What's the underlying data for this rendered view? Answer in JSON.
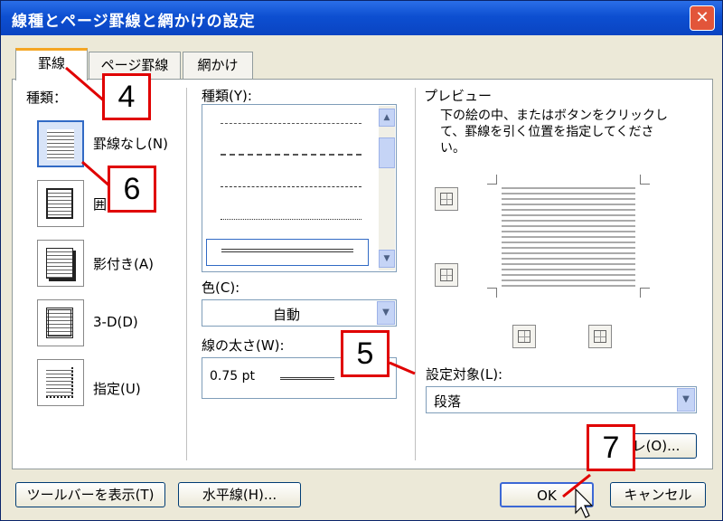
{
  "window": {
    "title": "線種とページ罫線と網かけの設定",
    "close_glyph": "✕"
  },
  "tabs": [
    {
      "label": "罫線"
    },
    {
      "label": "ページ罫線"
    },
    {
      "label": "網かけ"
    }
  ],
  "setting": {
    "label": "種類：",
    "items": [
      {
        "label": "罫線なし(N)"
      },
      {
        "label": "囲"
      },
      {
        "label": "影付き(A)"
      },
      {
        "label": "3-D(D)"
      },
      {
        "label": "指定(U)"
      }
    ]
  },
  "style": {
    "label": "種類(Y):",
    "scroll_up": "▲",
    "scroll_down": "▼"
  },
  "color": {
    "label": "色(C):",
    "value": "自動",
    "dropdown_glyph": "▼"
  },
  "width": {
    "label": "線の太さ(W):",
    "value": "0.75 pt"
  },
  "preview": {
    "label": "プレビュー",
    "instructions": "下の絵の中、またはボタンをクリックして、罫線を引く位置を指定してください。"
  },
  "apply_to": {
    "label": "設定対象(L):",
    "value": "段落",
    "dropdown_glyph": "▼"
  },
  "options_button": {
    "label": "レ(O)..."
  },
  "footer": {
    "toolbar_button": "ツールバーを表示(T)",
    "hline_button": "水平線(H)...",
    "ok_button": "OK",
    "cancel_button": "キャンセル"
  },
  "callouts": [
    "4",
    "6",
    "5",
    "7"
  ],
  "colors": {
    "titlebar": "#0d4fd1",
    "callout": "#e00000",
    "tab_highlight": "#f5a623"
  }
}
